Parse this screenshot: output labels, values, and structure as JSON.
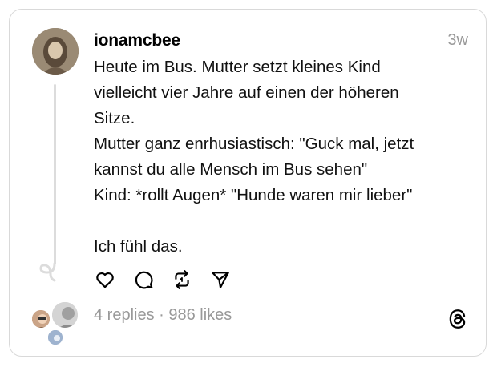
{
  "post": {
    "username": "ionamcbee",
    "time": "3w",
    "text": "Heute im Bus. Mutter setzt kleines Kind\nvielleicht vier Jahre auf einen der höheren\nSitze.\nMutter ganz enrhusiastisch: \"Guck mal, jetzt\nkannst du alle Mensch im Bus sehen\"\nKind: *rollt Augen* \"Hunde waren mir lieber\"\n\nIch fühl das."
  },
  "actions": {
    "like_icon": "heart-icon",
    "comment_icon": "comment-icon",
    "repost_icon": "repost-icon",
    "share_icon": "send-icon"
  },
  "stats": {
    "text": "4 replies · 986 likes"
  },
  "brand": {
    "logo_icon": "threads-logo-icon"
  }
}
